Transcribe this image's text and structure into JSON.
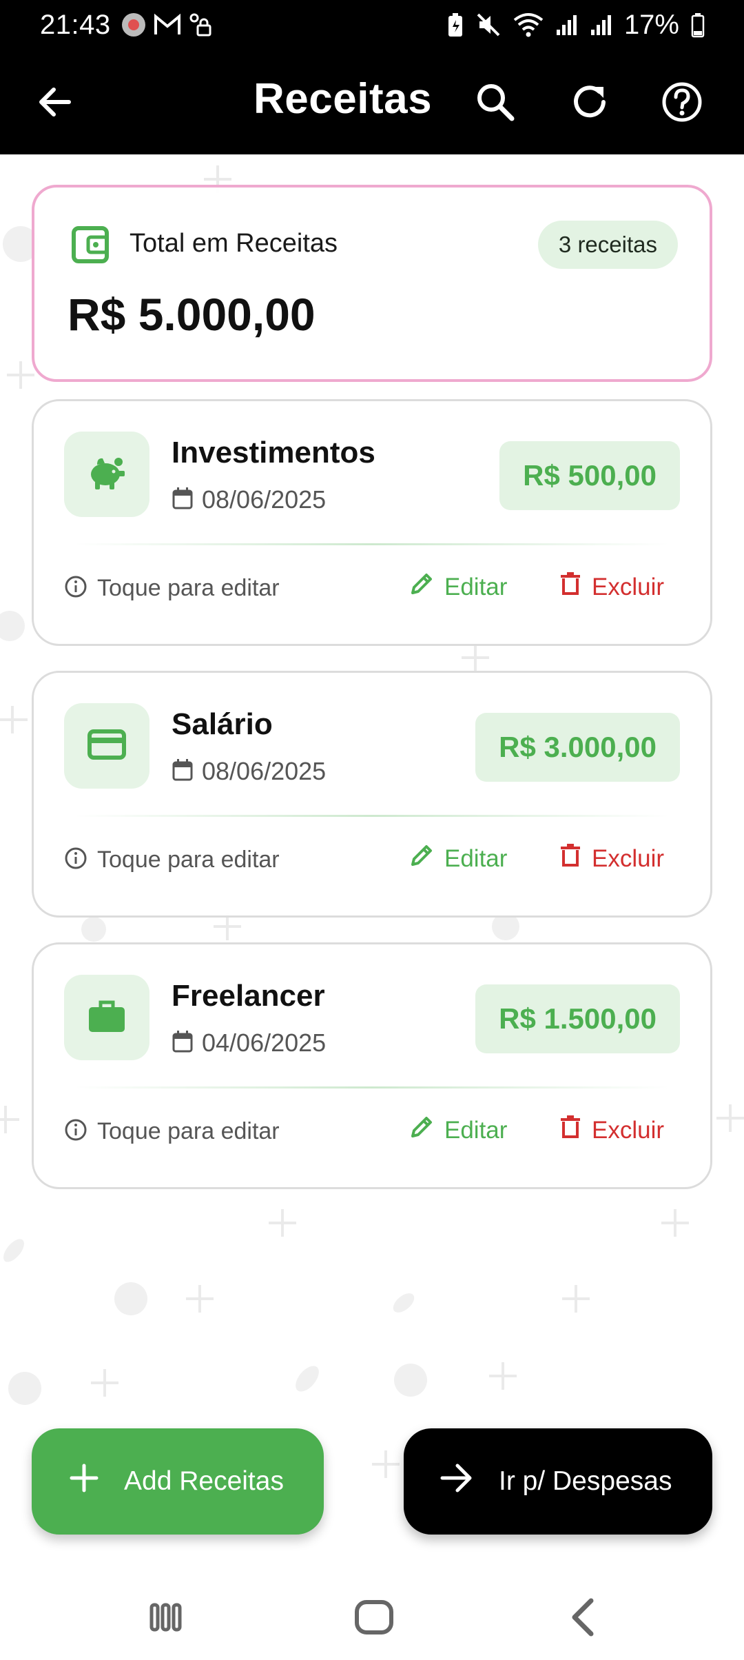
{
  "status_bar": {
    "time": "21:43",
    "battery": "17%"
  },
  "app_bar": {
    "title": "Receitas"
  },
  "summary": {
    "label": "Total em Receitas",
    "badge": "3 receitas",
    "total": "R$ 5.000,00"
  },
  "incomes": [
    {
      "name": "Investimentos",
      "date": "08/06/2025",
      "amount": "R$ 500,00",
      "icon": "piggy-bank-icon"
    },
    {
      "name": "Salário",
      "date": "08/06/2025",
      "amount": "R$ 3.000,00",
      "icon": "credit-card-icon"
    },
    {
      "name": "Freelancer",
      "date": "04/06/2025",
      "amount": "R$ 1.500,00",
      "icon": "briefcase-icon"
    }
  ],
  "card_actions": {
    "hint": "Toque para editar",
    "edit": "Editar",
    "delete": "Excluir"
  },
  "buttons": {
    "add": "Add Receitas",
    "go_expenses": "Ir p/ Despesas"
  },
  "colors": {
    "accent_green": "#4caf50",
    "danger_red": "#d32f2f",
    "summary_border": "#efa9cf",
    "badge_bg": "#e3f3e3"
  }
}
